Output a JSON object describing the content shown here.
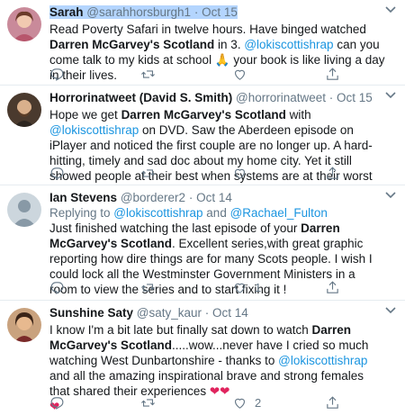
{
  "tweets": [
    {
      "name": "Sarah",
      "handle": "@sarahhorsburgh1",
      "sep": " · ",
      "date": "Oct 15",
      "text_a": "Read Poverty Safari in twelve hours. Have binged watched ",
      "bold_a": "Darren McGarvey's Scotland",
      "text_b": " in 3. ",
      "mention_a": "@lokiscottishrap",
      "text_c": " can you come talk to my kids at school 🙏 your book is like living a day in their lives.",
      "replies": "",
      "retweets": "",
      "likes": ""
    },
    {
      "name": "Horrorinatweet (David S. Smith)",
      "handle": "@horrorinatweet",
      "sep": " · ",
      "date": "Oct 15",
      "text_a": "Hope we get ",
      "bold_a": "Darren McGarvey's Scotland",
      "text_b": " with ",
      "mention_a": "@lokiscottishrap",
      "text_c": " on DVD. Saw the Aberdeen episode on iPlayer and noticed the first couple are no longer up. A hard-hitting, timely and sad doc about my home city. Yet it still showed people at their best when systems are at their worst",
      "replies": "",
      "retweets": "",
      "likes": ""
    },
    {
      "name": "Ian Stevens",
      "handle": "@borderer2",
      "sep": " · ",
      "date": "Oct 14",
      "reply_prefix": "Replying to ",
      "reply_to_1": "@lokiscottishrap",
      "reply_and": " and ",
      "reply_to_2": "@Rachael_Fulton",
      "text_a": "Just finished watching the last episode of your ",
      "bold_a": "Darren McGarvey's Scotland",
      "text_b": ". Excellent series,with great graphic reporting how dire things are for many Scots people. I wish I could lock all the Westminster Government Ministers in a room to view the series and to start fixing it !",
      "replies": "",
      "retweets": "",
      "likes": "1"
    },
    {
      "name": "Sunshine Saty",
      "handle": "@saty_kaur",
      "sep": " · ",
      "date": "Oct 14",
      "text_a": "I know I'm a bit late but finally sat down to watch ",
      "bold_a": "Darren McGarvey's Scotland",
      "text_b": ".....wow...never have I cried so much watching West Dunbartonshire - thanks to ",
      "mention_a": "@lokiscottishrap",
      "text_c": " and all the amazing inspirational brave and strong females that shared their experiences ",
      "hearts": "❤❤",
      "heart_end": "❤",
      "replies": "",
      "retweets": "",
      "likes": "2"
    }
  ],
  "colors": {
    "accent": "#1b95e0",
    "meta": "#657786",
    "divider": "#e6ecf0",
    "selection": "#b4d5fe",
    "heart": "#e0245e"
  },
  "icons": [
    "chevron-down-icon",
    "reply-icon",
    "retweet-icon",
    "like-icon",
    "share-icon"
  ]
}
